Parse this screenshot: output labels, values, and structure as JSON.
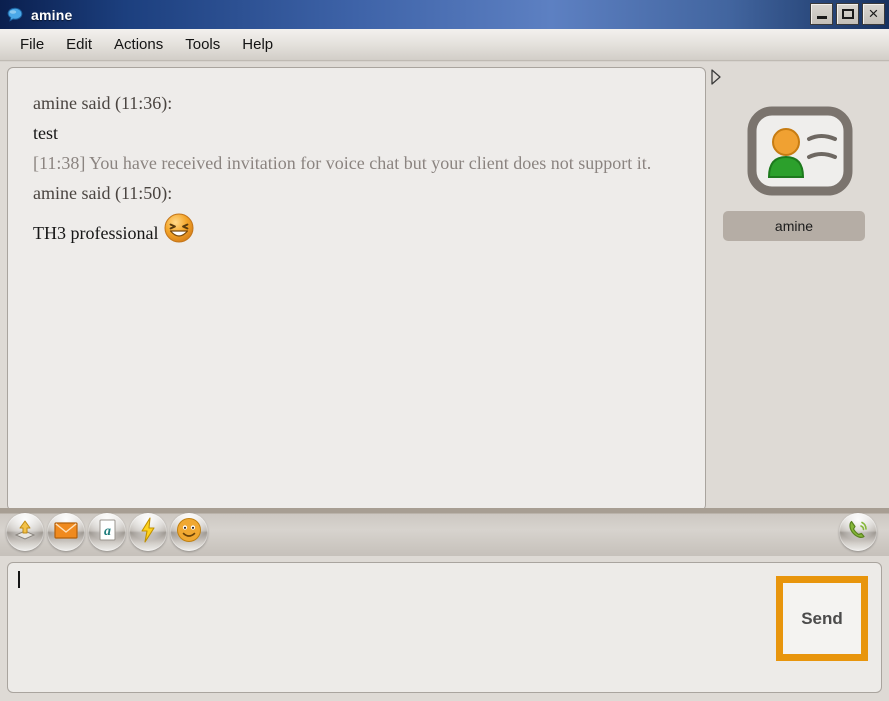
{
  "window": {
    "title": "amine",
    "icon": "speech-bubble-icon",
    "controls": [
      {
        "name": "minimize-button",
        "glyph": "minimize-icon",
        "label": "_"
      },
      {
        "name": "maximize-button",
        "glyph": "maximize-icon",
        "label": "□"
      },
      {
        "name": "close-button",
        "glyph": "close-icon",
        "label": "×"
      }
    ]
  },
  "menubar": {
    "items": [
      {
        "label": "File"
      },
      {
        "label": "Edit"
      },
      {
        "label": "Actions"
      },
      {
        "label": "Tools"
      },
      {
        "label": "Help"
      }
    ]
  },
  "chat": {
    "lines": [
      {
        "kind": "meta",
        "text": "amine said (11:36):"
      },
      {
        "kind": "body",
        "text": "test"
      },
      {
        "kind": "system",
        "text": "[11:38] You have received invitation for voice chat but your client does not support it."
      },
      {
        "kind": "meta",
        "text": "amine said (11:50):"
      }
    ],
    "last_message": {
      "text": "TH3 professional",
      "emoji": "grinning-squint-emoji"
    },
    "splitter_handle": "collapse-arrow-icon"
  },
  "contact": {
    "avatar_icon": "contact-card-avatar-icon",
    "name": "amine"
  },
  "toolbar": {
    "left_buttons": [
      {
        "name": "send-file-button",
        "icon": "upload-file-icon"
      },
      {
        "name": "send-email-button",
        "icon": "envelope-icon"
      },
      {
        "name": "font-format-button",
        "icon": "font-letter-a-icon"
      },
      {
        "name": "nudge-buzz-button",
        "icon": "lightning-bolt-icon"
      },
      {
        "name": "emoticon-button",
        "icon": "smiley-face-icon"
      }
    ],
    "right_buttons": [
      {
        "name": "voice-call-button",
        "icon": "green-phone-icon"
      }
    ]
  },
  "compose": {
    "value": "",
    "placeholder": "",
    "send_label": "Send"
  },
  "colors": {
    "titlebar_blue": "#3e63a8",
    "send_border_orange": "#e8950c",
    "panel_bg": "#eeecea",
    "window_bg": "#dedad5",
    "contact_chip": "#b5ada5"
  }
}
